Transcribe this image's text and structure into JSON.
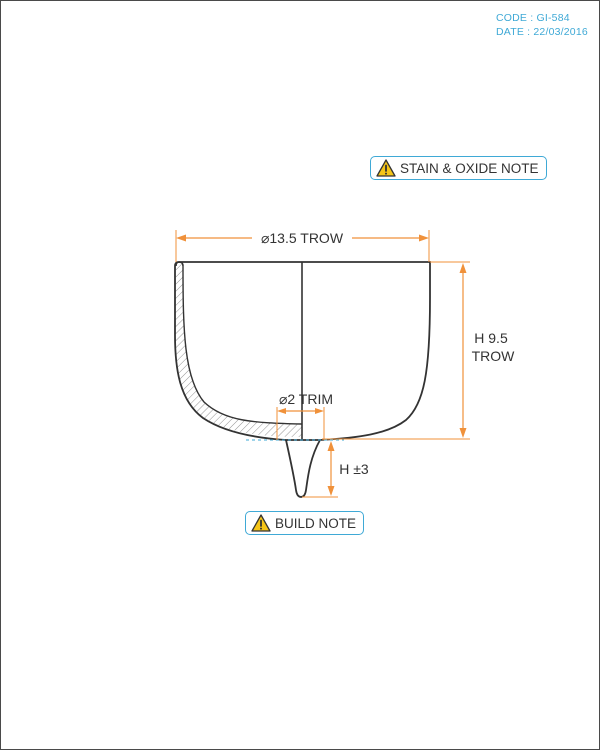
{
  "meta": {
    "code": "CODE : GI-584",
    "date": "DATE : 22/03/2016"
  },
  "notes": {
    "stain_oxide": "STAIN & OXIDE NOTE",
    "build": "BUILD NOTE"
  },
  "dimensions": {
    "diameter": "⌀13.5 TROW",
    "height_line1": "H 9.5",
    "height_line2": "TROW",
    "trim": "⌀2 TRIM",
    "foot_height": "H ±3"
  },
  "colors": {
    "accent": "#3fa9d6",
    "dimension": "#f0913a",
    "outline": "#333333",
    "hatch": "#777777"
  },
  "icons": {
    "note_icon": "warning-triangle-icon"
  }
}
